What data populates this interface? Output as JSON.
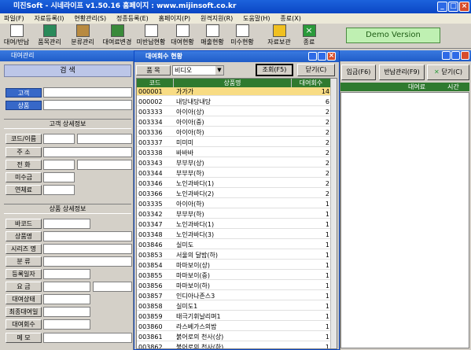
{
  "app": {
    "title": "미진Soft - 시네라이프 v1.50.16 홈페이지 : www.mijinsoft.co.kr"
  },
  "menu": [
    "파일(F)",
    "자료등록(I)",
    "현황관리(S)",
    "정종등록(E)",
    "홈페이지(P)",
    "원격지원(R)",
    "도움말(H)",
    "종료(X)"
  ],
  "toolbar": {
    "items": [
      "대여/반납",
      "품목관리",
      "분류관리",
      "대여료변경",
      "미반납현황",
      "대여현황",
      "매출현황",
      "미수현황",
      "자료보관",
      "종료"
    ],
    "demo": "Demo Version"
  },
  "rental": {
    "title": "대여관리",
    "search_header": "검    색",
    "customer_btn": "고객",
    "product_btn": "상품",
    "customer_info_header": "고객 상세정보",
    "customer_fields": [
      "코드/이름",
      "주  소",
      "전  화",
      "미수금",
      "연체료"
    ],
    "product_info_header": "상품 상세정보",
    "product_fields": [
      "바코드",
      "상품명",
      "시리즈 명",
      "분  류",
      "등록일자",
      "요  금",
      "대여상태",
      "최종대여일",
      "대여회수",
      "메  모"
    ]
  },
  "right": {
    "input_btn": "입금(F6)",
    "return_btn": "반납관리(F9)",
    "close_btn": "닫기(C)",
    "col_fee": "대여료",
    "col_time": "시간"
  },
  "dialog": {
    "title": "대여회수 현황",
    "filter_label": "품  목",
    "filter_value": "비디오",
    "search_btn": "조회(F5)",
    "close_btn": "닫기(C)",
    "columns": [
      "코드",
      "상품명",
      "대여회수"
    ],
    "rows": [
      [
        "000001",
        "가가가",
        "14"
      ],
      [
        "000002",
        "내당내당내당",
        "6"
      ],
      [
        "003333",
        "아이아(상)",
        "2"
      ],
      [
        "003334",
        "아이아(중)",
        "2"
      ],
      [
        "003336",
        "아이아(하)",
        "2"
      ],
      [
        "003337",
        "미미미",
        "2"
      ],
      [
        "003338",
        "바바바",
        "2"
      ],
      [
        "003343",
        "부부부(상)",
        "2"
      ],
      [
        "003344",
        "부부부(하)",
        "2"
      ],
      [
        "003346",
        "노인과바다(1)",
        "2"
      ],
      [
        "003366",
        "노인과바다(2)",
        "2"
      ],
      [
        "003335",
        "아이아(하)",
        "1"
      ],
      [
        "003342",
        "부부부(하)",
        "1"
      ],
      [
        "003347",
        "노인과바다(1)",
        "1"
      ],
      [
        "003348",
        "노인과바다(3)",
        "1"
      ],
      [
        "003846",
        "실미도",
        "1"
      ],
      [
        "003853",
        "서울의 달밤(하)",
        "1"
      ],
      [
        "003854",
        "마마보이(상)",
        "1"
      ],
      [
        "003855",
        "마마보이(중)",
        "1"
      ],
      [
        "003856",
        "마마보이(하)",
        "1"
      ],
      [
        "003857",
        "인디아나존스3",
        "1"
      ],
      [
        "003858",
        "실미도1",
        "1"
      ],
      [
        "003859",
        "태극기휘날리며1",
        "1"
      ],
      [
        "003860",
        "라스베가스의밤",
        "1"
      ],
      [
        "003861",
        "붉어로의 천사(상)",
        "1"
      ],
      [
        "003862",
        "붉어로의 천사(하)",
        "1"
      ]
    ]
  },
  "colors": {
    "title_blue": "#0a46c4",
    "header_green": "#2f7a2f",
    "selected_row": "#f8dc84",
    "demo_bg": "#bff0b2"
  }
}
